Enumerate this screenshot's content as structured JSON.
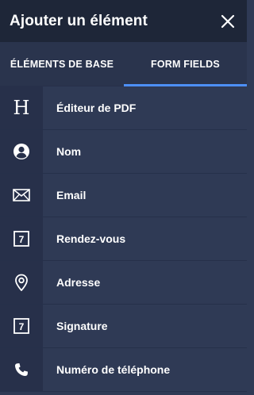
{
  "header": {
    "title": "Ajouter un élément"
  },
  "tabs": [
    {
      "label": "ÉLÉMENTS DE BASE",
      "active": false
    },
    {
      "label": "FORM FIELDS",
      "active": true
    }
  ],
  "items": [
    {
      "label": "Éditeur de PDF",
      "icon": "heading-icon",
      "icon_text": "H"
    },
    {
      "label": "Nom",
      "icon": "user-icon"
    },
    {
      "label": "Email",
      "icon": "envelope-icon"
    },
    {
      "label": "Rendez-vous",
      "icon": "calendar-icon",
      "icon_text": "7"
    },
    {
      "label": "Adresse",
      "icon": "location-pin-icon"
    },
    {
      "label": "Signature",
      "icon": "calendar-icon",
      "icon_text": "7"
    },
    {
      "label": "Numéro de téléphone",
      "icon": "phone-icon"
    }
  ],
  "colors": {
    "header_bg": "#1e2638",
    "panel_bg": "#2f3a55",
    "icon_column_bg": "#27304a",
    "active_tab_underline": "#4d8ff7"
  }
}
